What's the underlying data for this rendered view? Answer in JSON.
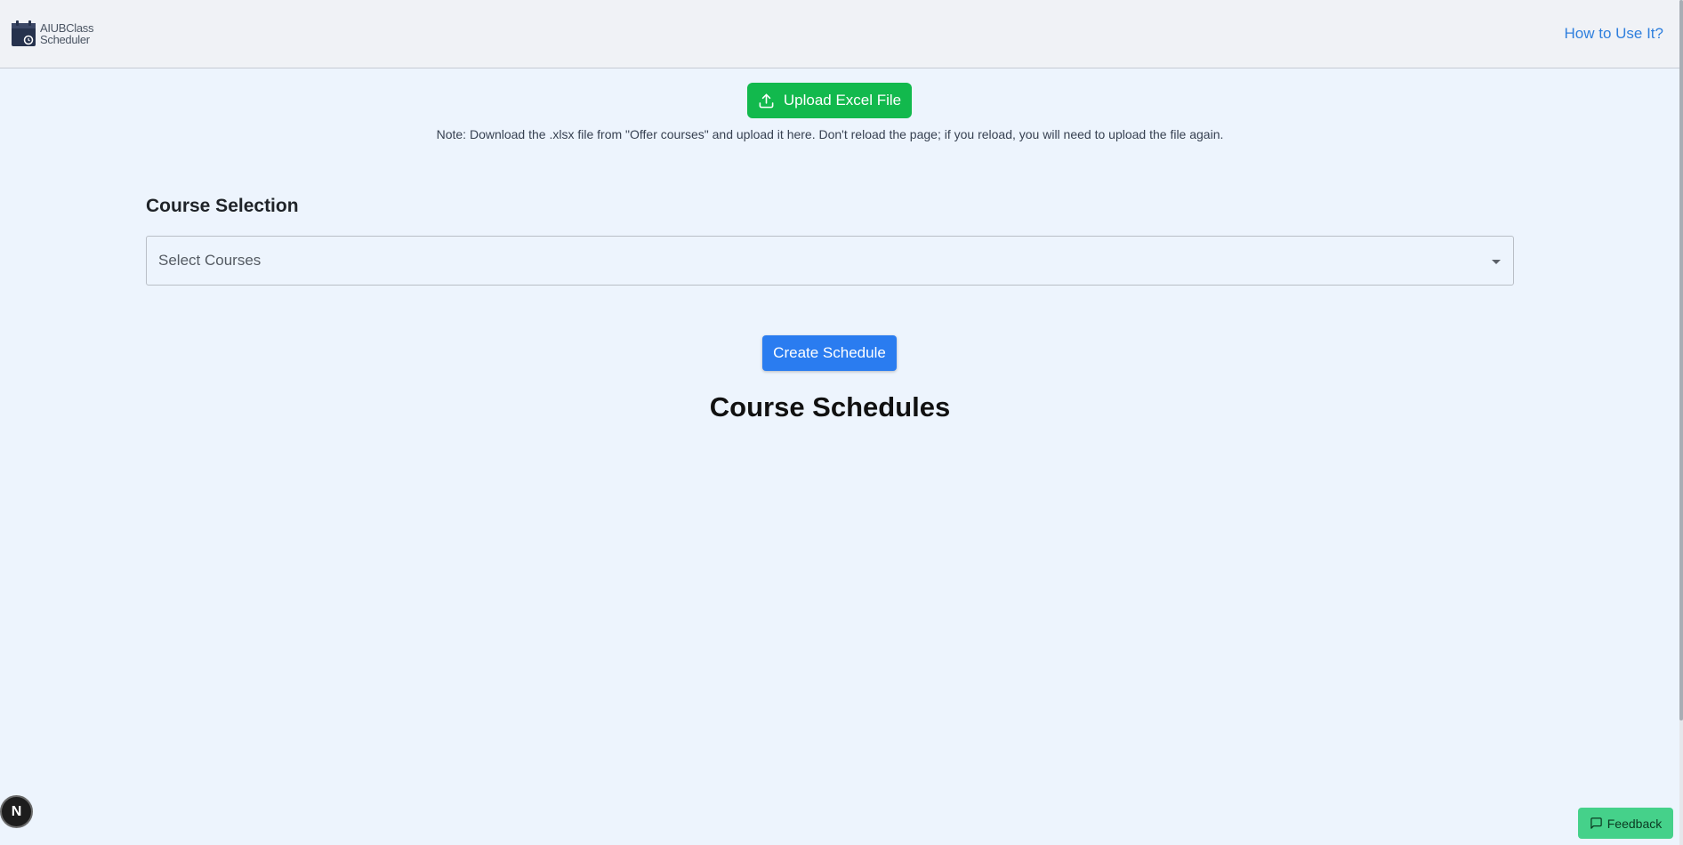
{
  "header": {
    "logo_line1": "AIUBClass",
    "logo_line2": "Scheduler",
    "how_link": "How to Use It?"
  },
  "upload": {
    "button_label": "Upload Excel File",
    "note": "Note: Download the .xlsx file from \"Offer courses\" and upload it here. Don't reload the page; if you reload, you will need to upload the file again."
  },
  "course_selection": {
    "title": "Course Selection",
    "placeholder": "Select Courses"
  },
  "actions": {
    "create_label": "Create Schedule"
  },
  "schedules": {
    "title": "Course Schedules"
  },
  "widgets": {
    "n_badge": "N",
    "feedback_label": "Feedback"
  },
  "colors": {
    "upload_green": "#12b94d",
    "create_blue": "#2a7cf0",
    "link_blue": "#2f7fdd",
    "feedback_green": "#45d18a",
    "page_bg": "#edf4fd",
    "header_bg": "#f0f2f6"
  },
  "icons": {
    "logo": "calendar-icon",
    "upload": "upload-icon",
    "select": "chevron-down-icon",
    "feedback": "message-square-icon"
  }
}
